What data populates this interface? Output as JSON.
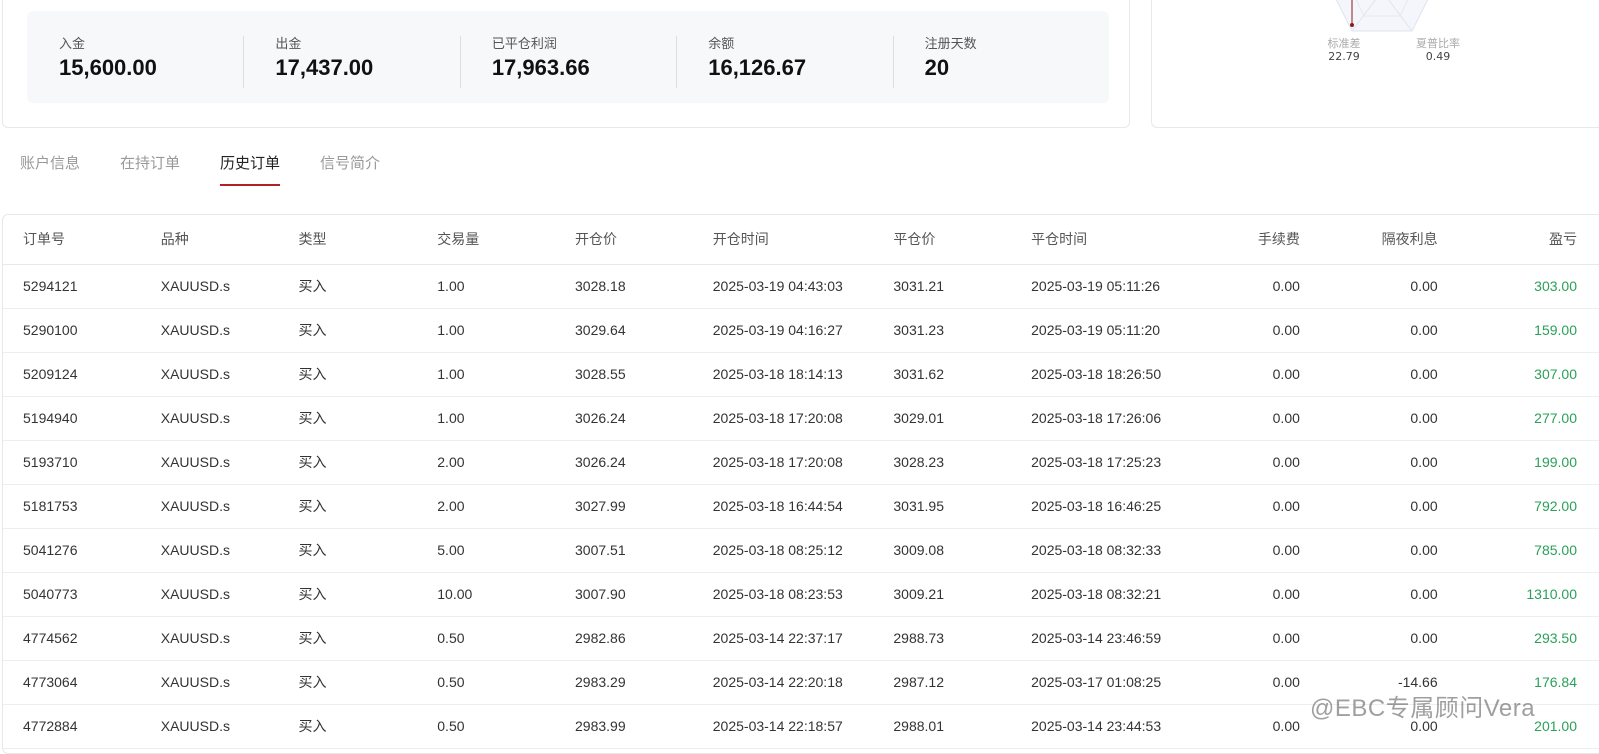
{
  "stats": [
    {
      "label": "入金",
      "value": "15,600.00"
    },
    {
      "label": "出金",
      "value": "17,437.00"
    },
    {
      "label": "已平仓利润",
      "value": "17,963.66"
    },
    {
      "label": "余额",
      "value": "16,126.67"
    },
    {
      "label": "注册天数",
      "value": "20"
    }
  ],
  "radar": {
    "items": [
      {
        "label": "标准差",
        "value": "22.79"
      },
      {
        "label": "夏普比率",
        "value": "0.49"
      }
    ]
  },
  "tabs": [
    {
      "label": "账户信息"
    },
    {
      "label": "在持订单"
    },
    {
      "label": "历史订单"
    },
    {
      "label": "信号简介"
    }
  ],
  "active_tab": "历史订单",
  "table": {
    "headers": [
      "订单号",
      "品种",
      "类型",
      "交易量",
      "开仓价",
      "开仓时间",
      "平仓价",
      "平仓时间",
      "手续费",
      "隔夜利息",
      "盈亏"
    ],
    "rows": [
      [
        "5294121",
        "XAUUSD.s",
        "买入",
        "1.00",
        "3028.18",
        "2025-03-19 04:43:03",
        "3031.21",
        "2025-03-19 05:11:26",
        "0.00",
        "0.00",
        "303.00"
      ],
      [
        "5290100",
        "XAUUSD.s",
        "买入",
        "1.00",
        "3029.64",
        "2025-03-19 04:16:27",
        "3031.23",
        "2025-03-19 05:11:20",
        "0.00",
        "0.00",
        "159.00"
      ],
      [
        "5209124",
        "XAUUSD.s",
        "买入",
        "1.00",
        "3028.55",
        "2025-03-18 18:14:13",
        "3031.62",
        "2025-03-18 18:26:50",
        "0.00",
        "0.00",
        "307.00"
      ],
      [
        "5194940",
        "XAUUSD.s",
        "买入",
        "1.00",
        "3026.24",
        "2025-03-18 17:20:08",
        "3029.01",
        "2025-03-18 17:26:06",
        "0.00",
        "0.00",
        "277.00"
      ],
      [
        "5193710",
        "XAUUSD.s",
        "买入",
        "2.00",
        "3026.24",
        "2025-03-18 17:20:08",
        "3028.23",
        "2025-03-18 17:25:23",
        "0.00",
        "0.00",
        "199.00"
      ],
      [
        "5181753",
        "XAUUSD.s",
        "买入",
        "2.00",
        "3027.99",
        "2025-03-18 16:44:54",
        "3031.95",
        "2025-03-18 16:46:25",
        "0.00",
        "0.00",
        "792.00"
      ],
      [
        "5041276",
        "XAUUSD.s",
        "买入",
        "5.00",
        "3007.51",
        "2025-03-18 08:25:12",
        "3009.08",
        "2025-03-18 08:32:33",
        "0.00",
        "0.00",
        "785.00"
      ],
      [
        "5040773",
        "XAUUSD.s",
        "买入",
        "10.00",
        "3007.90",
        "2025-03-18 08:23:53",
        "3009.21",
        "2025-03-18 08:32:21",
        "0.00",
        "0.00",
        "1310.00"
      ],
      [
        "4774562",
        "XAUUSD.s",
        "买入",
        "0.50",
        "2982.86",
        "2025-03-14 22:37:17",
        "2988.73",
        "2025-03-14 23:46:59",
        "0.00",
        "0.00",
        "293.50"
      ],
      [
        "4773064",
        "XAUUSD.s",
        "买入",
        "0.50",
        "2983.29",
        "2025-03-14 22:20:18",
        "2987.12",
        "2025-03-17 01:08:25",
        "0.00",
        "-14.66",
        "176.84"
      ],
      [
        "4772884",
        "XAUUSD.s",
        "买入",
        "0.50",
        "2983.99",
        "2025-03-14 22:18:57",
        "2988.01",
        "2025-03-14 23:44:53",
        "0.00",
        "0.00",
        "201.00"
      ]
    ]
  },
  "watermark": "@EBC专属顾问Vera",
  "colors": {
    "profit": "#2aa05a",
    "tab_underline": "#b22222",
    "radar_line": "#8b1a1a"
  }
}
